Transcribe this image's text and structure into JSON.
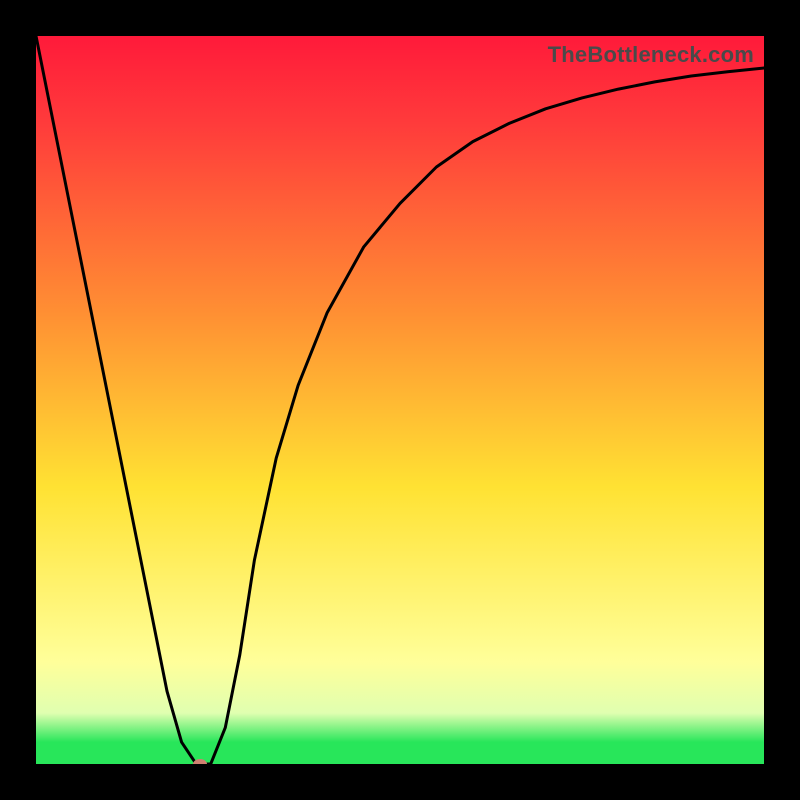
{
  "watermark": "TheBottleneck.com",
  "colors": {
    "red": "#ff1a3a",
    "red2": "#ff3b3b",
    "orange": "#ff8f33",
    "yellow": "#ffe233",
    "paleyellow": "#ffff9a",
    "paleyellow2": "#e0ffb0",
    "green": "#28e65a",
    "curve": "#000000",
    "marker": "#d08070"
  },
  "chart_data": {
    "type": "line",
    "title": "",
    "xlabel": "",
    "ylabel": "",
    "xlim": [
      0,
      100
    ],
    "ylim": [
      0,
      100
    ],
    "grid": false,
    "legend": false,
    "series": [
      {
        "name": "bottleneck-curve",
        "x": [
          0,
          5,
          10,
          15,
          18,
          20,
          22,
          24,
          26,
          28,
          30,
          33,
          36,
          40,
          45,
          50,
          55,
          60,
          65,
          70,
          75,
          80,
          85,
          90,
          95,
          100
        ],
        "y": [
          100,
          75,
          50,
          25,
          10,
          3,
          0,
          0,
          5,
          15,
          28,
          42,
          52,
          62,
          71,
          77,
          82,
          85.5,
          88,
          90,
          91.5,
          92.7,
          93.7,
          94.5,
          95.1,
          95.6
        ]
      }
    ],
    "annotations": [
      {
        "name": "min-marker",
        "x": 22.5,
        "y": 0
      }
    ],
    "note": "Background is a vertical spectrum (red→orange→yellow→green) indicating desirability; curve shows bottleneck severity with a sharp minimum near x≈22 then asymptotically rising."
  }
}
